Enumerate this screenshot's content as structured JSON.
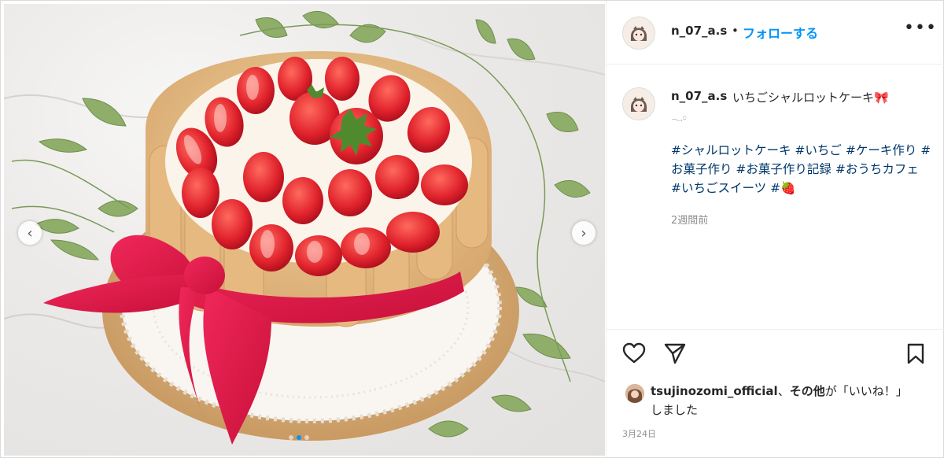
{
  "post": {
    "username": "n_07_a.s",
    "separator": "•",
    "follow_label": "フォローする",
    "more_icon": "ellipsis-icon"
  },
  "caption": {
    "username": "n_07_a.s",
    "text": "いちごシャルロットケーキ🎀",
    "continuation": "𓂃𓈒𓏸",
    "hashtags": "#シャルロットケーキ #いちご #ケーキ作り #お菓子作り #お菓子作り記録 #おうちカフェ #いちごスイーツ #🍓",
    "time_ago": "2週間前"
  },
  "actions": {
    "like_icon": "heart-icon",
    "share_icon": "paper-plane-icon",
    "save_icon": "bookmark-icon"
  },
  "likes": {
    "user": "tsujinozomi_official",
    "comma": "、",
    "others": "その他",
    "suffix": "が「いいね！」しました"
  },
  "date": "3月24日",
  "carousel": {
    "prev_icon": "chevron-left-icon",
    "next_icon": "chevron-right-icon",
    "slide_count": 3,
    "active_index": 1
  },
  "colors": {
    "link_blue": "#0095f6",
    "hashtag_blue": "#00376b",
    "ribbon_red": "#e3173f",
    "strawberry": "#e8262f"
  }
}
